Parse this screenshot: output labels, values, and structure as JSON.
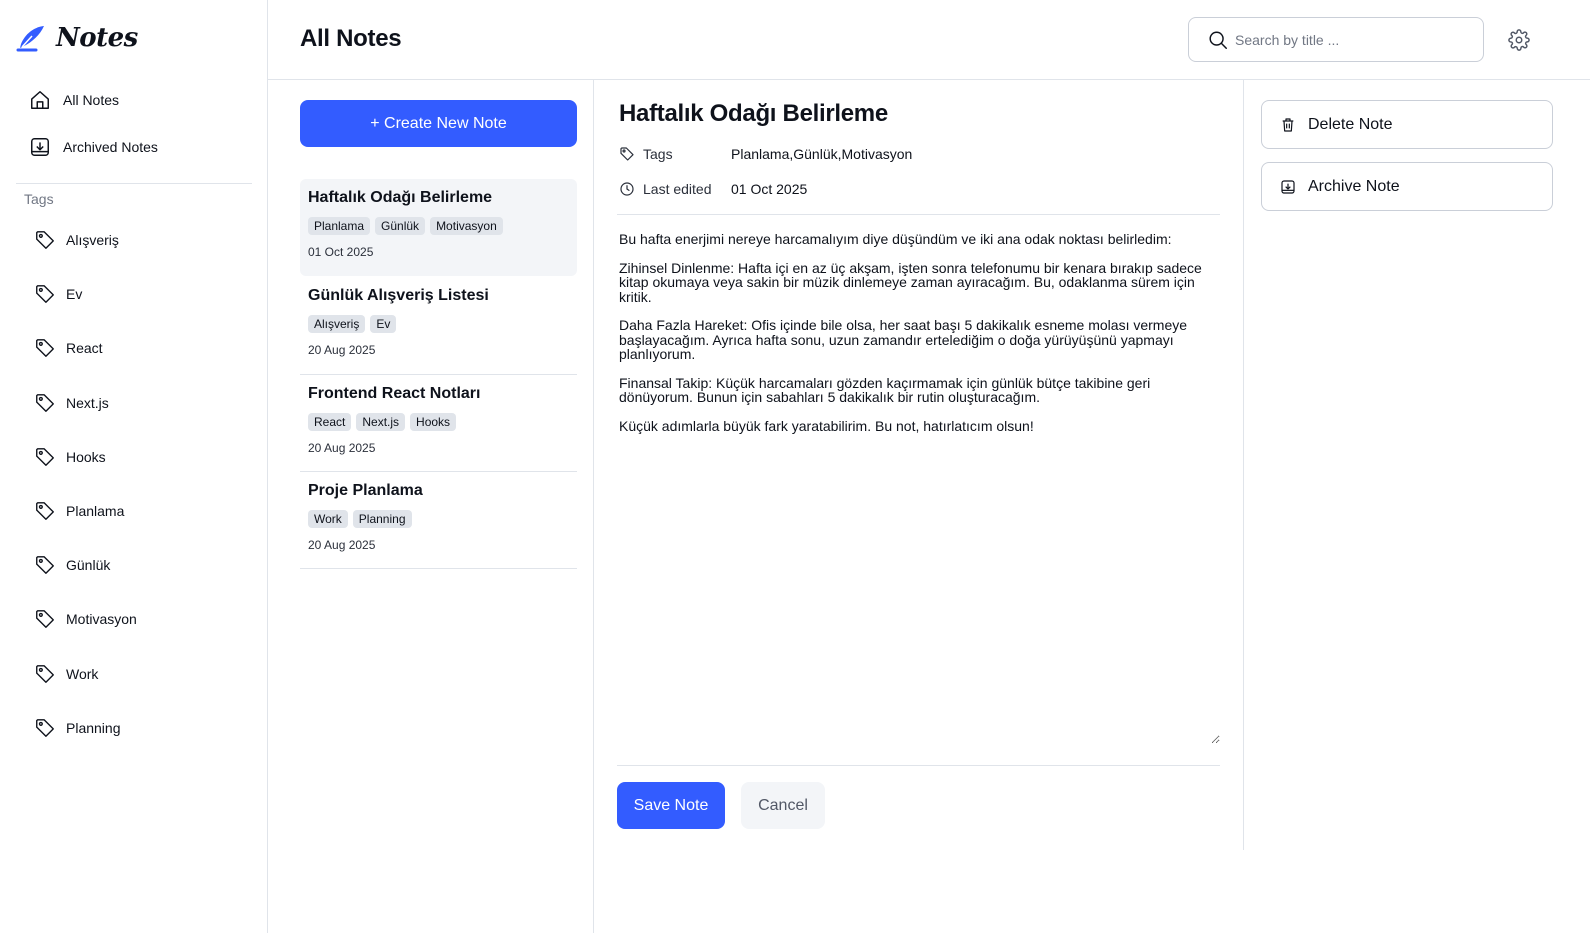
{
  "app": {
    "logo_text": "Notes"
  },
  "sidebar": {
    "nav": [
      {
        "label": "All Notes",
        "icon": "home-icon"
      },
      {
        "label": "Archived Notes",
        "icon": "archive-icon"
      }
    ],
    "tags_heading": "Tags",
    "tags": [
      "Alışveriş",
      "Ev",
      "React",
      "Next.js",
      "Hooks",
      "Planlama",
      "Günlük",
      "Motivasyon",
      "Work",
      "Planning"
    ]
  },
  "header": {
    "title": "All Notes",
    "search_placeholder": "Search by title ...",
    "settings_icon": "gear-icon"
  },
  "notes_list": {
    "create_label": "+ Create New Note",
    "notes": [
      {
        "title": "Haftalık Odağı Belirleme",
        "tags": [
          "Planlama",
          "Günlük",
          "Motivasyon"
        ],
        "date": "01 Oct 2025",
        "active": true
      },
      {
        "title": "Günlük Alışveriş Listesi",
        "tags": [
          "Alışveriş",
          "Ev"
        ],
        "date": "20 Aug 2025",
        "active": false
      },
      {
        "title": "Frontend React Notları",
        "tags": [
          "React",
          "Next.js",
          "Hooks"
        ],
        "date": "20 Aug 2025",
        "active": false
      },
      {
        "title": "Proje Planlama",
        "tags": [
          "Work",
          "Planning"
        ],
        "date": "20 Aug 2025",
        "active": false
      }
    ]
  },
  "editor": {
    "title": "Haftalık Odağı Belirleme",
    "tags_label": "Tags",
    "tags_value": "Planlama,Günlük,Motivasyon",
    "last_edited_label": "Last edited",
    "last_edited_value": "01 Oct 2025",
    "body": "Bu hafta enerjimi nereye harcamalıyım diye düşündüm ve iki ana odak noktası belirledim:\n\nZihinsel Dinlenme: Hafta içi en az üç akşam, işten sonra telefonumu bir kenara bırakıp sadece kitap okumaya veya sakin bir müzik dinlemeye zaman ayıracağım. Bu, odaklanma sürem için kritik.\n\nDaha Fazla Hareket: Ofis içinde bile olsa, her saat başı 5 dakikalık esneme molası vermeye başlayacağım. Ayrıca hafta sonu, uzun zamandır ertelediğim o doğa yürüyüşünü yapmayı planlıyorum.\n\nFinansal Takip: Küçük harcamaları gözden kaçırmamak için günlük bütçe takibine geri dönüyorum. Bunun için sabahları 5 dakikalık bir rutin oluşturacağım.\n\nKüçük adımlarla büyük fark yaratabilirim. Bu not, hatırlatıcım olsun!",
    "save_label": "Save Note",
    "cancel_label": "Cancel"
  },
  "actions": {
    "delete_label": "Delete Note",
    "archive_label": "Archive Note"
  },
  "colors": {
    "accent": "#335cff",
    "border": "#e0e4ea",
    "text": "#0e121b",
    "muted": "#717784"
  }
}
